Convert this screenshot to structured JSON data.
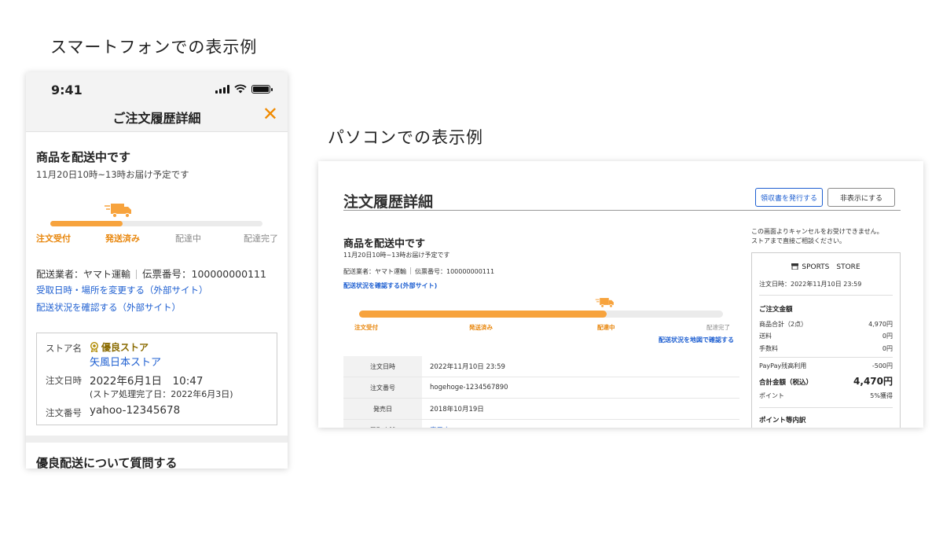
{
  "captions": {
    "smartphone": "スマートフォンでの表示例",
    "pc": "パソコンでの表示例"
  },
  "smartphone": {
    "status_time": "9:41",
    "header_title": "ご注文履歴詳細",
    "close_glyph": "✕",
    "status_title": "商品を配送中です",
    "eta": "11月20日10時~13時お届け予定です",
    "progress_percent": 34,
    "steps": [
      {
        "label": "注文受付",
        "done": true
      },
      {
        "label": "発送済み",
        "done": true
      },
      {
        "label": "配達中",
        "done": false
      },
      {
        "label": "配達完了",
        "done": false
      }
    ],
    "carrier_label": "配送業者：ヤマト運輸",
    "tracking": "伝票番号：100000000111",
    "link_change": "受取日時・場所を変更する（外部サイト）",
    "link_status": "配送状況を確認する（外部サイト）",
    "store_label": "ストア名",
    "store_badge": "優良ストア",
    "store_name": "矢風日本ストア",
    "order_date_label": "注文日時",
    "order_date": "2022年6月1日　10:47",
    "order_date_note": "(ストア処理完了日：2022年6月3日)",
    "order_no_label": "注文番号",
    "order_no": "yahoo-12345678",
    "faq_title": "優良配送について質問する"
  },
  "pc": {
    "title": "注文履歴詳細",
    "btn_receipt": "領収書を発行する",
    "btn_hide": "非表示にする",
    "status_title": "商品を配送中です",
    "eta": "11月20日10時~13時お届け予定です",
    "carrier_label": "配送業者：ヤマト運輸",
    "tracking": "伝票番号：100000000111",
    "link_status": "配送状況を確認する(外部サイト)",
    "link_map": "配送状況を地図で確認する",
    "progress_percent": 68,
    "steps": [
      {
        "label": "注文受付",
        "done": true
      },
      {
        "label": "発送済み",
        "done": true
      },
      {
        "label": "配達中",
        "done": true
      },
      {
        "label": "配達完了",
        "done": false
      }
    ],
    "table": [
      {
        "label": "注文日時",
        "value": "2022年11月10日 23:59",
        "link": false
      },
      {
        "label": "注文番号",
        "value": "hogehoge-1234567890",
        "link": false
      },
      {
        "label": "発売日",
        "value": "2018年10月19日",
        "link": false
      },
      {
        "label": "受取店舗",
        "value": "表示中",
        "link": true
      }
    ],
    "notice_line1": "この画面よりキャンセルをお受けできません。",
    "notice_line2": "ストアまで直接ご相談ください。",
    "store_name": "SPORTS　STORE",
    "side_order_date": "注文日時：2022年11月10日 23:59",
    "amount_title": "ご注文金額",
    "subtotal_label": "商品合計（2点）",
    "subtotal_value": "4,970円",
    "shipping_label": "送料",
    "shipping_value": "0円",
    "fee_label": "手数料",
    "fee_value": "0円",
    "paypay_label": "PayPay残高利用",
    "paypay_value": "-500円",
    "total_label": "合計金額（税込）",
    "total_value": "4,470円",
    "points_label": "ポイント",
    "points_value": "5%獲得",
    "points_breakdown": "ポイント等内訳"
  },
  "colors": {
    "accent_orange": "#f7a33d",
    "step_orange": "#e8870e",
    "link_blue": "#1e5fd1"
  }
}
